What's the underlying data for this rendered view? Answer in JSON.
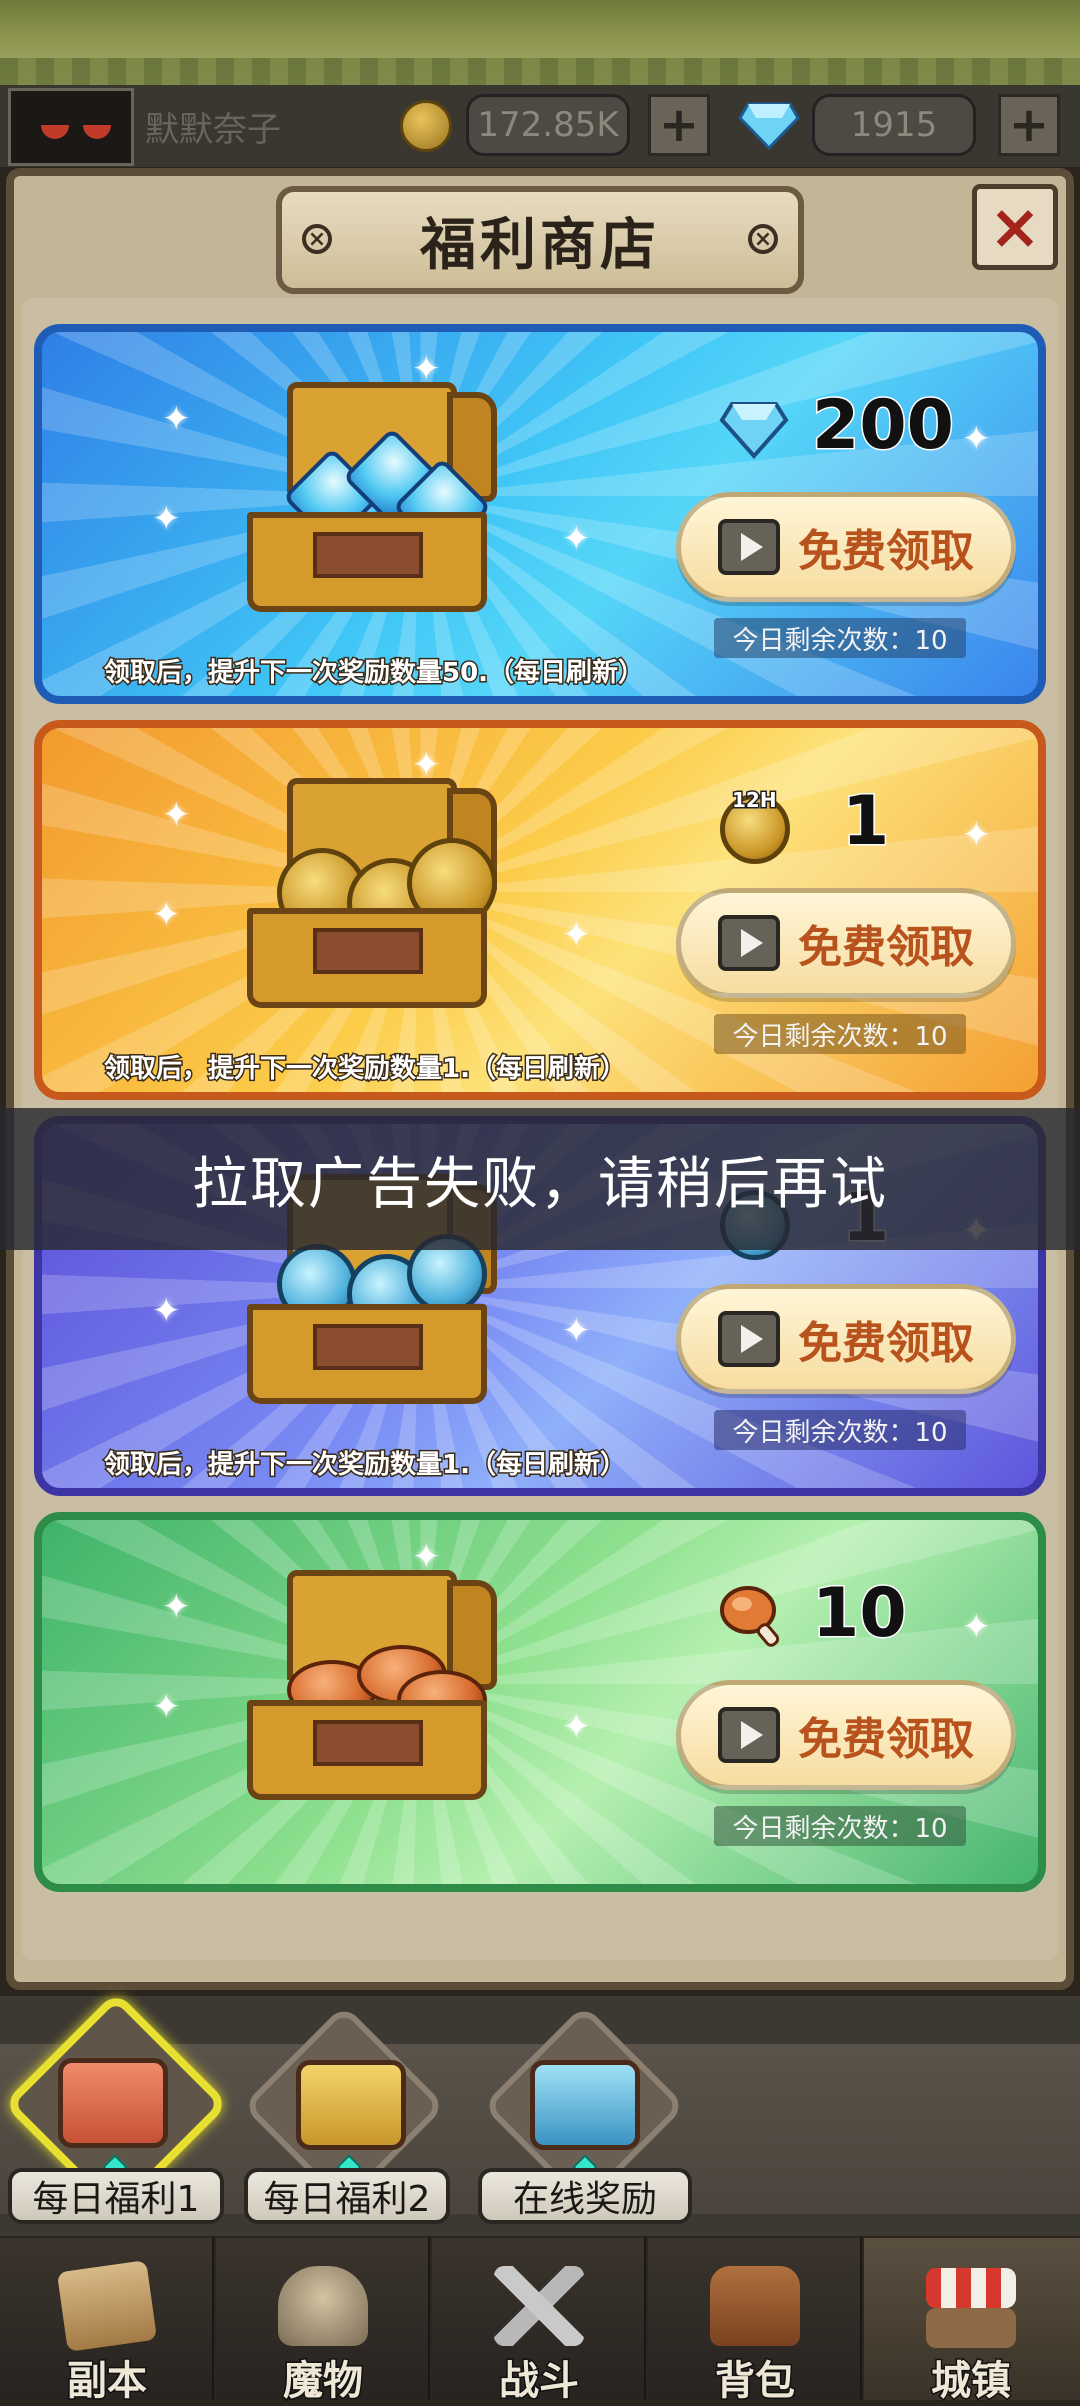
{
  "player": {
    "name": "默默奈子"
  },
  "currency": {
    "gold": {
      "icon": "gold-coin-icon",
      "value": "172.85K"
    },
    "gems": {
      "icon": "diamond-icon",
      "value": "1915"
    },
    "add_label": "+"
  },
  "dialog": {
    "title": "福利商店",
    "close_label": "×"
  },
  "rewards": [
    {
      "id": "diamonds",
      "icon": "diamond-icon",
      "amount": "200",
      "button_label": "免费领取",
      "remaining": "今日剩余次数：10",
      "description": "领取后，提升下一次奖励数量50.（每日刷新）",
      "theme": "#3aa3ee"
    },
    {
      "id": "gold-12h",
      "icon": "gold-coin-12h-icon",
      "icon_badge": "12H",
      "amount": "1",
      "button_label": "免费领取",
      "remaining": "今日剩余次数：10",
      "description": "领取后，提升下一次奖励数量1.（每日刷新）",
      "theme": "#f5b53a"
    },
    {
      "id": "blue-coin",
      "icon": "blue-coin-icon",
      "amount": "1",
      "button_label": "免费领取",
      "remaining": "今日剩余次数：10",
      "description": "领取后，提升下一次奖励数量1.（每日刷新）",
      "theme": "#6b78ee"
    },
    {
      "id": "meat",
      "icon": "meat-drumstick-icon",
      "amount": "10",
      "button_label": "免费领取",
      "remaining": "今日剩余次数：10",
      "description": "",
      "theme": "#5cc77b"
    }
  ],
  "toast": "拉取广告失败，请稍后再试",
  "tabs": [
    {
      "label": "每日福利1",
      "icon": "red-chest-icon",
      "active": true
    },
    {
      "label": "每日福利2",
      "icon": "gold-chest-icon",
      "active": false
    },
    {
      "label": "在线奖励",
      "icon": "blue-chest-icon",
      "active": false
    }
  ],
  "nav": [
    {
      "label": "副本",
      "icon": "map-scroll-icon"
    },
    {
      "label": "魔物",
      "icon": "monster-helmet-icon"
    },
    {
      "label": "战斗",
      "icon": "crossed-swords-icon"
    },
    {
      "label": "背包",
      "icon": "backpack-icon"
    },
    {
      "label": "城镇",
      "icon": "town-shop-icon",
      "active": true
    }
  ]
}
